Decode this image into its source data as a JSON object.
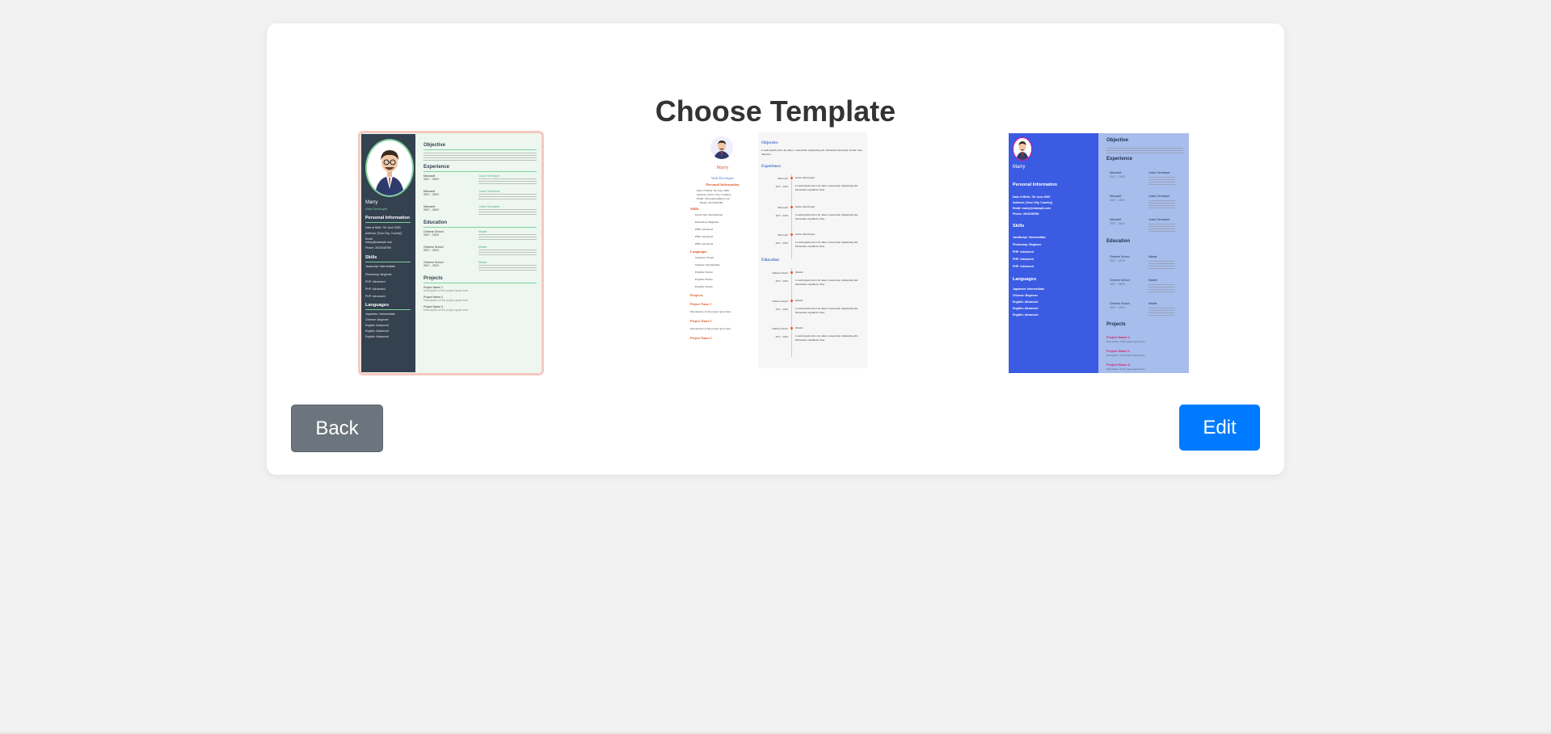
{
  "page": {
    "title": "Choose Template"
  },
  "actions": {
    "back_label": "Back",
    "edit_label": "Edit"
  },
  "colors": {
    "edit": "#007bff",
    "back": "#6c757d",
    "t1_sidebar": "#34414f",
    "t1_accent": "#7fd09a",
    "t2_accent": "#e05a2b",
    "t3_sidebar": "#3b5be3",
    "t3_main": "#a7bdeb"
  },
  "templates": [
    {
      "selected": true,
      "name": "Marry",
      "role": "Web Developer",
      "sections": {
        "personal": "Personal Information",
        "skills": "Skills",
        "languages": "Languages",
        "objective": "Objective",
        "experience": "Experience",
        "education": "Education",
        "projects": "Projects"
      },
      "personal": [
        "Date of Birth: 7th June 2000",
        "Address: [Your City, Country]",
        "Email:",
        "marry@example.com",
        "Phone: 2615248789"
      ],
      "skills": [
        "Javascript: Intermediate",
        "Photoshop: Beginner",
        "PHP: Advanced",
        "PHP: Advanced",
        "PHP: Advanced"
      ],
      "languages": [
        "Japanese: Intermediate",
        "Chinese: Beginner",
        "English: Advanced",
        "English: Advanced",
        "English: Advanced"
      ],
      "experience": [
        {
          "company": "Microsoft",
          "years": "2017 - 2019",
          "title": "Junior Developer"
        },
        {
          "company": "Microsoft",
          "years": "2017 - 2019",
          "title": "Junior Developer"
        },
        {
          "company": "Microsoft",
          "years": "2017 - 2019",
          "title": "Junior Developer"
        }
      ],
      "education": [
        {
          "school": "Chinese School",
          "years": "2017 - 2019",
          "degree": "Master"
        },
        {
          "school": "Chinese School",
          "years": "2017 - 2019",
          "degree": "Master"
        },
        {
          "school": "Chinese School",
          "years": "2017 - 2019",
          "degree": "Master"
        }
      ],
      "projects": [
        {
          "name": "Project Name 1",
          "desc": "Description of the project goes here."
        },
        {
          "name": "Project Name 2",
          "desc": "Description of the project goes here."
        },
        {
          "name": "Project Name 3",
          "desc": "Description of the project goes here."
        }
      ]
    },
    {
      "selected": false,
      "name": "Marry",
      "role": "Web Developer",
      "sections": {
        "personal": "Personal Information",
        "skills": "Skills",
        "languages": "Languages",
        "projects": "Projects",
        "objective": "Objective",
        "experience": "Experience",
        "education": "Education"
      },
      "personal": [
        "Date of Birth: 7th June 2000",
        "Address: [Your City, Country]",
        "Email: marry@example.com",
        "Phone: 2615248789"
      ],
      "skills": [
        "JavaScript: Intermediate",
        "Photoshop: Beginner",
        "PHP: Advanced",
        "PHP: Advanced",
        "PHP: Advanced"
      ],
      "languages": [
        "Japanese: Fluent",
        "Chinese: Intermediate",
        "English: Native",
        "English: Native",
        "English: Native"
      ],
      "projects": [
        {
          "name": "Project Name 1",
          "desc": "Description of the project goes here."
        },
        {
          "name": "Project Name 2",
          "desc": "Description of the project goes here."
        },
        {
          "name": "Project Name 3",
          "desc": ""
        }
      ],
      "objective": "Lorem ipsum dolor sit amet, consectetur adipisicing elit. Molestiae molestias facilis vitae delectus.",
      "timeline_exp": [
        {
          "company": "Microsoft",
          "years": "2017 - 2019",
          "title": "Junior Developer",
          "text": "Lorem ipsum dolor sit amet consectetur adipisicing elit. Molestiae cupiditate vitae"
        },
        {
          "company": "Microsoft",
          "years": "2017 - 2019",
          "title": "Junior Developer",
          "text": "Lorem ipsum dolor sit amet consectetur adipisicing elit. Molestiae cupiditate vitae"
        },
        {
          "company": "Microsoft",
          "years": "2017 - 2019",
          "title": "Junior Developer",
          "text": "Lorem ipsum dolor sit amet consectetur adipisicing elit. Molestiae cupiditate vitae"
        }
      ],
      "timeline_edu": [
        {
          "school": "Chinese School",
          "years": "2017 - 2019",
          "degree": "Master",
          "text": "Lorem ipsum dolor sit amet consectetur adipisicing elit. Molestiae cupiditate vitae"
        },
        {
          "school": "Chinese School",
          "years": "2017 - 2019",
          "degree": "Master",
          "text": "Lorem ipsum dolor sit amet consectetur adipisicing elit. Molestiae cupiditate vitae"
        },
        {
          "school": "Chinese School",
          "years": "2017 - 2019",
          "degree": "Master",
          "text": "Lorem ipsum dolor sit amet consectetur adipisicing elit. Molestiae cupiditate vitae"
        }
      ]
    },
    {
      "selected": false,
      "name": "Marry",
      "sections": {
        "personal": "Personal Information",
        "skills": "Skills",
        "languages": "Languages",
        "objective": "Objective",
        "experience": "Experience",
        "education": "Education",
        "projects": "Projects"
      },
      "personal": [
        "Date of Birth: 7th June 2000",
        "Address: [Your City, Country]",
        "Email: marry@example.com",
        "Phone: 2615248789"
      ],
      "skills": [
        "JavaScript: Intermediate",
        "Photoshop: Beginner",
        "PHP: Advanced",
        "PHP: Advanced",
        "PHP: Advanced"
      ],
      "languages": [
        "Japanese: Intermediate",
        "Chinese: Beginner",
        "English: Advanced",
        "English: Advanced",
        "English: Advanced"
      ],
      "experience": [
        {
          "company": "Microsoft",
          "years": "2017 - 2019",
          "title": "Junior Developer"
        },
        {
          "company": "Microsoft",
          "years": "2017 - 2019",
          "title": "Junior Developer"
        },
        {
          "company": "Microsoft",
          "years": "2017 - 2019",
          "title": "Junior Developer"
        }
      ],
      "education": [
        {
          "school": "Chinese School",
          "years": "2017 - 2019",
          "degree": "Master"
        },
        {
          "school": "Chinese School",
          "years": "2017 - 2019",
          "degree": "Master"
        },
        {
          "school": "Chinese School",
          "years": "2017 - 2019",
          "degree": "Master"
        }
      ],
      "projects": [
        {
          "name": "Project Name 1",
          "desc": "Description of the project goes here."
        },
        {
          "name": "Project Name 2",
          "desc": "Description of the project goes here."
        },
        {
          "name": "Project Name 3",
          "desc": "Description of the project goes here."
        }
      ]
    }
  ]
}
